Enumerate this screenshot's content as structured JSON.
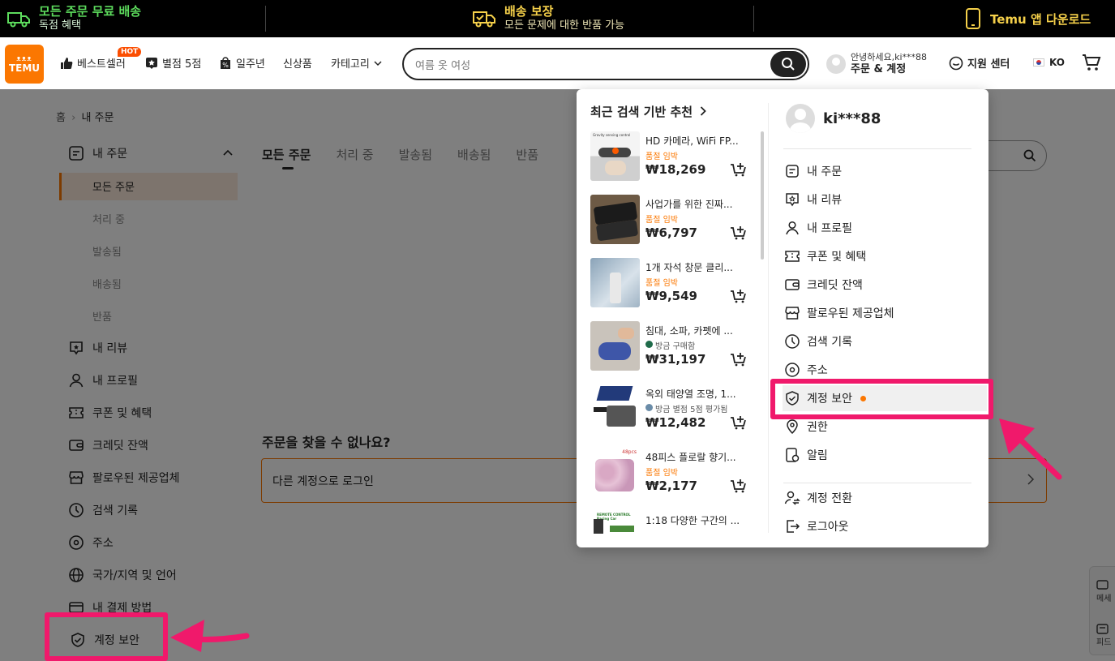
{
  "promo": {
    "left_title": "모든 주문 무료 배송",
    "left_sub": "독점 혜택",
    "mid_title": "배송 보장",
    "mid_sub": "모든 문제에 대한 반품 가능",
    "right_title": "Temu 앱 다운로드"
  },
  "header": {
    "logo_top": "ᴥᴥᴥ",
    "logo_text": "TEMU",
    "nav": {
      "bestseller": "베스트셀러",
      "hot": "HOT",
      "five_star": "별점 5점",
      "anniversary": "일주년",
      "new": "신상품",
      "category": "카테고리"
    },
    "search_placeholder": "여름 옷 여성",
    "user_greeting": "안녕하세요,ki***88",
    "user_orders": "주문 & 계정",
    "support": "지원 센터",
    "lang": "KO"
  },
  "page": {
    "breadcrumb_home": "홈",
    "breadcrumb_current": "내 주문",
    "sidebar": {
      "my_orders": "내 주문",
      "subs": [
        "모든 주문",
        "처리 중",
        "발송됨",
        "배송됨",
        "반품"
      ],
      "items": [
        "내 리뷰",
        "내 프로필",
        "쿠폰 및 혜택",
        "크레딧 잔액",
        "팔로우된 제공업체",
        "검색 기록",
        "주소",
        "국가/지역 및 언어",
        "내 결제 방법",
        "계정 보안"
      ]
    },
    "tabs": [
      "모든 주문",
      "처리 중",
      "발송됨",
      "배송됨",
      "반품"
    ],
    "notfound": "주문을 찾을 수 없나요?",
    "login_other": "다른 계정으로 로그인",
    "float_tools": [
      "메세",
      "피드"
    ]
  },
  "dropdown": {
    "rec_title": "최근 검색 기반 추천",
    "products": [
      {
        "name": "HD 카메라, WiFi FP...",
        "sub": "품절 임박",
        "price": "₩18,269",
        "img_text": "Gravity sensing control"
      },
      {
        "name": "사업가를 위한 진짜...",
        "sub": "품절 임박",
        "price": "₩6,797",
        "img_text": ""
      },
      {
        "name": "1개 자석 창문 클리...",
        "sub": "품절 임박",
        "price": "₩9,549",
        "img_text": ""
      },
      {
        "name": "침대, 소파, 카펫에 ...",
        "sub": "방금 구매함",
        "price": "₩31,197",
        "img_text": ""
      },
      {
        "name": "옥외 태양열 조명, 1...",
        "sub": "방금 별점 5점 평가됨",
        "price": "₩12,482",
        "img_text": ""
      },
      {
        "name": "48피스 플로랄 향기...",
        "sub": "품절 임박",
        "price": "₩2,177",
        "img_text": "48pcs"
      },
      {
        "name": "1:18 다양한 구간의 ...",
        "sub": "",
        "price": "",
        "img_text": "REMOTE CONTROL Racing Car"
      }
    ],
    "account_name": "ki***88",
    "menu": [
      "내 주문",
      "내 리뷰",
      "내 프로필",
      "쿠폰 및 혜택",
      "크레딧 잔액",
      "팔로우된 제공업체",
      "검색 기록",
      "주소",
      "계정 보안",
      "권한",
      "알림"
    ],
    "menu2": [
      "계정 전환",
      "로그아웃"
    ]
  },
  "colors": {
    "accent": "#fb7701",
    "highlight": "#f0196b",
    "promo_green": "#5ddc5d",
    "promo_yellow": "#f5d04a"
  }
}
